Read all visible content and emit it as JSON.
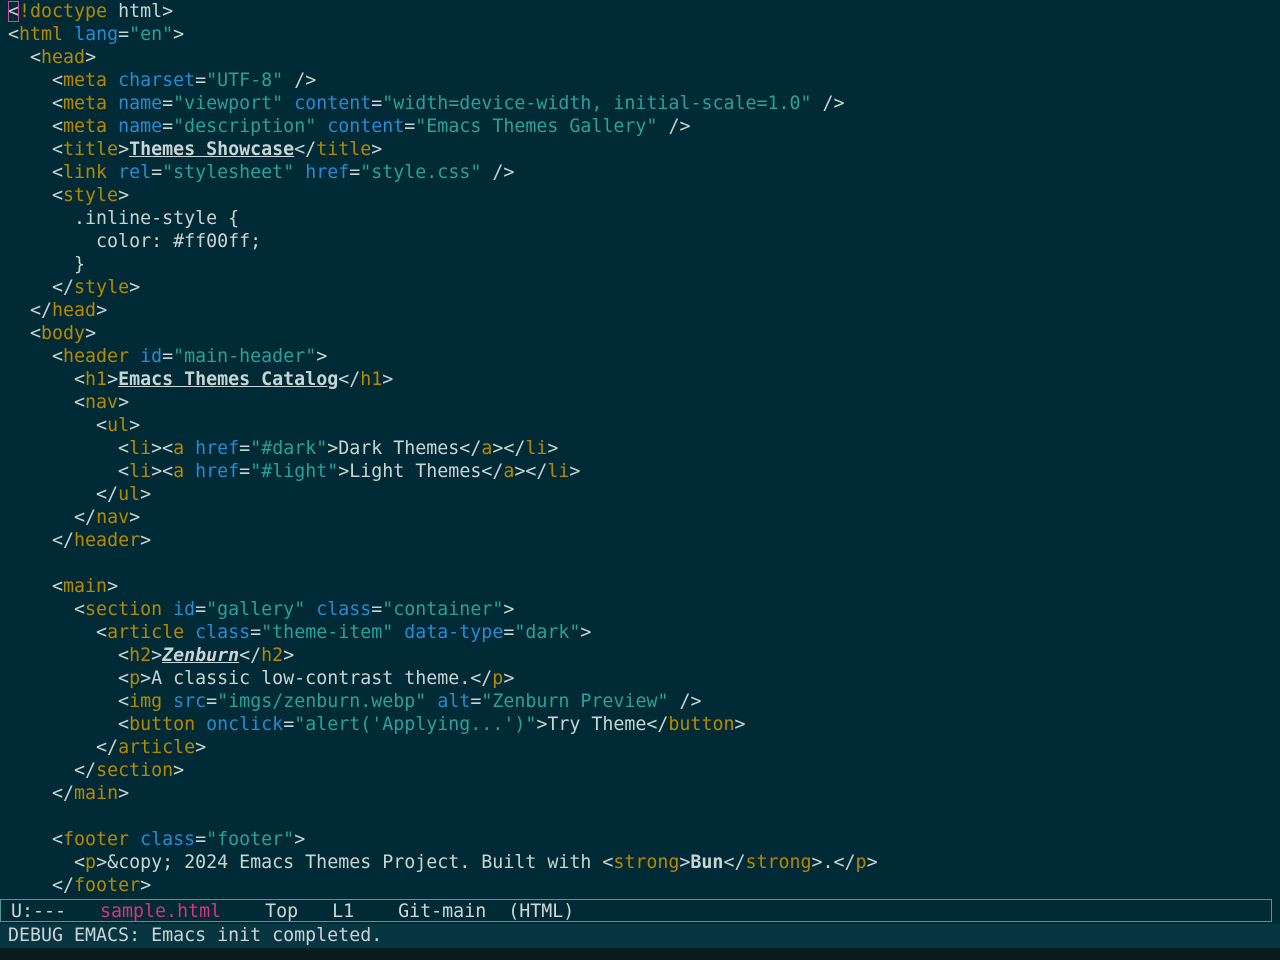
{
  "colors": {
    "background": "#002b36",
    "tag": "#b58900",
    "attribute": "#268bd2",
    "string": "#2aa198",
    "text": "#c9d4d4",
    "buffer_name": "#d33682",
    "echo_background": "#073642"
  },
  "lines": [
    [
      [
        "t",
        "<"
      ],
      [
        "tag",
        "!doctype"
      ],
      [
        "t",
        " html>"
      ]
    ],
    [
      [
        "t",
        "<"
      ],
      [
        "tag",
        "html"
      ],
      [
        "t",
        " "
      ],
      [
        "attr",
        "lang"
      ],
      [
        "t",
        "="
      ],
      [
        "str",
        "\"en\""
      ],
      [
        "t",
        ">"
      ]
    ],
    [
      [
        "t",
        "  <"
      ],
      [
        "tag",
        "head"
      ],
      [
        "t",
        ">"
      ]
    ],
    [
      [
        "t",
        "    <"
      ],
      [
        "tag",
        "meta"
      ],
      [
        "t",
        " "
      ],
      [
        "attr",
        "charset"
      ],
      [
        "t",
        "="
      ],
      [
        "str",
        "\"UTF-8\""
      ],
      [
        "t",
        " />"
      ]
    ],
    [
      [
        "t",
        "    <"
      ],
      [
        "tag",
        "meta"
      ],
      [
        "t",
        " "
      ],
      [
        "attr",
        "name"
      ],
      [
        "t",
        "="
      ],
      [
        "str",
        "\"viewport\""
      ],
      [
        "t",
        " "
      ],
      [
        "attr",
        "content"
      ],
      [
        "t",
        "="
      ],
      [
        "str",
        "\"width=device-width, initial-scale=1.0\""
      ],
      [
        "t",
        " />"
      ]
    ],
    [
      [
        "t",
        "    <"
      ],
      [
        "tag",
        "meta"
      ],
      [
        "t",
        " "
      ],
      [
        "attr",
        "name"
      ],
      [
        "t",
        "="
      ],
      [
        "str",
        "\"description\""
      ],
      [
        "t",
        " "
      ],
      [
        "attr",
        "content"
      ],
      [
        "t",
        "="
      ],
      [
        "str",
        "\"Emacs Themes Gallery\""
      ],
      [
        "t",
        " />"
      ]
    ],
    [
      [
        "t",
        "    <"
      ],
      [
        "tag",
        "title"
      ],
      [
        "t",
        ">"
      ],
      [
        "title",
        "Themes Showcase"
      ],
      [
        "t",
        "</"
      ],
      [
        "tag",
        "title"
      ],
      [
        "t",
        ">"
      ]
    ],
    [
      [
        "t",
        "    <"
      ],
      [
        "tag",
        "link"
      ],
      [
        "t",
        " "
      ],
      [
        "attr",
        "rel"
      ],
      [
        "t",
        "="
      ],
      [
        "str",
        "\"stylesheet\""
      ],
      [
        "t",
        " "
      ],
      [
        "attr",
        "href"
      ],
      [
        "t",
        "="
      ],
      [
        "str",
        "\"style.css\""
      ],
      [
        "t",
        " />"
      ]
    ],
    [
      [
        "t",
        "    <"
      ],
      [
        "tag",
        "style"
      ],
      [
        "t",
        ">"
      ]
    ],
    [
      [
        "t",
        "      .inline-style {"
      ]
    ],
    [
      [
        "t",
        "        color: #ff00ff;"
      ]
    ],
    [
      [
        "t",
        "      }"
      ]
    ],
    [
      [
        "t",
        "    </"
      ],
      [
        "tag",
        "style"
      ],
      [
        "t",
        ">"
      ]
    ],
    [
      [
        "t",
        "  </"
      ],
      [
        "tag",
        "head"
      ],
      [
        "t",
        ">"
      ]
    ],
    [
      [
        "t",
        "  <"
      ],
      [
        "tag",
        "body"
      ],
      [
        "t",
        ">"
      ]
    ],
    [
      [
        "t",
        "    <"
      ],
      [
        "tag",
        "header"
      ],
      [
        "t",
        " "
      ],
      [
        "attr",
        "id"
      ],
      [
        "t",
        "="
      ],
      [
        "str",
        "\"main-header\""
      ],
      [
        "t",
        ">"
      ]
    ],
    [
      [
        "t",
        "      <"
      ],
      [
        "tag",
        "h1"
      ],
      [
        "t",
        ">"
      ],
      [
        "title",
        "Emacs Themes Catalog"
      ],
      [
        "t",
        "</"
      ],
      [
        "tag",
        "h1"
      ],
      [
        "t",
        ">"
      ]
    ],
    [
      [
        "t",
        "      <"
      ],
      [
        "tag",
        "nav"
      ],
      [
        "t",
        ">"
      ]
    ],
    [
      [
        "t",
        "        <"
      ],
      [
        "tag",
        "ul"
      ],
      [
        "t",
        ">"
      ]
    ],
    [
      [
        "t",
        "          <"
      ],
      [
        "tag",
        "li"
      ],
      [
        "t",
        "><"
      ],
      [
        "tag",
        "a"
      ],
      [
        "t",
        " "
      ],
      [
        "attr",
        "href"
      ],
      [
        "t",
        "="
      ],
      [
        "str",
        "\"#dark\""
      ],
      [
        "t",
        ">Dark Themes</"
      ],
      [
        "tag",
        "a"
      ],
      [
        "t",
        "></"
      ],
      [
        "tag",
        "li"
      ],
      [
        "t",
        ">"
      ]
    ],
    [
      [
        "t",
        "          <"
      ],
      [
        "tag",
        "li"
      ],
      [
        "t",
        "><"
      ],
      [
        "tag",
        "a"
      ],
      [
        "t",
        " "
      ],
      [
        "attr",
        "href"
      ],
      [
        "t",
        "="
      ],
      [
        "str",
        "\"#light\""
      ],
      [
        "t",
        ">Light Themes</"
      ],
      [
        "tag",
        "a"
      ],
      [
        "t",
        "></"
      ],
      [
        "tag",
        "li"
      ],
      [
        "t",
        ">"
      ]
    ],
    [
      [
        "t",
        "        </"
      ],
      [
        "tag",
        "ul"
      ],
      [
        "t",
        ">"
      ]
    ],
    [
      [
        "t",
        "      </"
      ],
      [
        "tag",
        "nav"
      ],
      [
        "t",
        ">"
      ]
    ],
    [
      [
        "t",
        "    </"
      ],
      [
        "tag",
        "header"
      ],
      [
        "t",
        ">"
      ]
    ],
    [
      [
        "t",
        ""
      ]
    ],
    [
      [
        "t",
        "    <"
      ],
      [
        "tag",
        "main"
      ],
      [
        "t",
        ">"
      ]
    ],
    [
      [
        "t",
        "      <"
      ],
      [
        "tag",
        "section"
      ],
      [
        "t",
        " "
      ],
      [
        "attr",
        "id"
      ],
      [
        "t",
        "="
      ],
      [
        "str",
        "\"gallery\""
      ],
      [
        "t",
        " "
      ],
      [
        "attr",
        "class"
      ],
      [
        "t",
        "="
      ],
      [
        "str",
        "\"container\""
      ],
      [
        "t",
        ">"
      ]
    ],
    [
      [
        "t",
        "        <"
      ],
      [
        "tag",
        "article"
      ],
      [
        "t",
        " "
      ],
      [
        "attr",
        "class"
      ],
      [
        "t",
        "="
      ],
      [
        "str",
        "\"theme-item\""
      ],
      [
        "t",
        " "
      ],
      [
        "attr",
        "data-type"
      ],
      [
        "t",
        "="
      ],
      [
        "str",
        "\"dark\""
      ],
      [
        "t",
        ">"
      ]
    ],
    [
      [
        "t",
        "          <"
      ],
      [
        "tag",
        "h2"
      ],
      [
        "t",
        ">"
      ],
      [
        "h2",
        "Zenburn"
      ],
      [
        "t",
        "</"
      ],
      [
        "tag",
        "h2"
      ],
      [
        "t",
        ">"
      ]
    ],
    [
      [
        "t",
        "          <"
      ],
      [
        "tag",
        "p"
      ],
      [
        "t",
        ">A classic low-contrast theme.</"
      ],
      [
        "tag",
        "p"
      ],
      [
        "t",
        ">"
      ]
    ],
    [
      [
        "t",
        "          <"
      ],
      [
        "tag",
        "img"
      ],
      [
        "t",
        " "
      ],
      [
        "attr",
        "src"
      ],
      [
        "t",
        "="
      ],
      [
        "str",
        "\"imgs/zenburn.webp\""
      ],
      [
        "t",
        " "
      ],
      [
        "attr",
        "alt"
      ],
      [
        "t",
        "="
      ],
      [
        "str",
        "\"Zenburn Preview\""
      ],
      [
        "t",
        " />"
      ]
    ],
    [
      [
        "t",
        "          <"
      ],
      [
        "tag",
        "button"
      ],
      [
        "t",
        " "
      ],
      [
        "attr",
        "onclick"
      ],
      [
        "t",
        "="
      ],
      [
        "str",
        "\"alert('Applying...')\""
      ],
      [
        "t",
        ">Try Theme</"
      ],
      [
        "tag",
        "button"
      ],
      [
        "t",
        ">"
      ]
    ],
    [
      [
        "t",
        "        </"
      ],
      [
        "tag",
        "article"
      ],
      [
        "t",
        ">"
      ]
    ],
    [
      [
        "t",
        "      </"
      ],
      [
        "tag",
        "section"
      ],
      [
        "t",
        ">"
      ]
    ],
    [
      [
        "t",
        "    </"
      ],
      [
        "tag",
        "main"
      ],
      [
        "t",
        ">"
      ]
    ],
    [
      [
        "t",
        ""
      ]
    ],
    [
      [
        "t",
        "    <"
      ],
      [
        "tag",
        "footer"
      ],
      [
        "t",
        " "
      ],
      [
        "attr",
        "class"
      ],
      [
        "t",
        "="
      ],
      [
        "str",
        "\"footer\""
      ],
      [
        "t",
        ">"
      ]
    ],
    [
      [
        "t",
        "      <"
      ],
      [
        "tag",
        "p"
      ],
      [
        "t",
        ">&copy; 2024 Emacs Themes Project. Built with <"
      ],
      [
        "tag",
        "strong"
      ],
      [
        "t",
        ">"
      ],
      [
        "bold",
        "Bun"
      ],
      [
        "t",
        "</"
      ],
      [
        "tag",
        "strong"
      ],
      [
        "t",
        ">.</"
      ],
      [
        "tag",
        "p"
      ],
      [
        "t",
        ">"
      ]
    ],
    [
      [
        "t",
        "    </"
      ],
      [
        "tag",
        "footer"
      ],
      [
        "t",
        ">"
      ]
    ]
  ],
  "modeline": {
    "status": "U:---",
    "buffer_name": "sample.html",
    "position": "Top",
    "line": "L1",
    "vc": "Git-main",
    "mode": "(HTML)"
  },
  "echo_area": {
    "message": "DEBUG EMACS: Emacs init completed."
  }
}
